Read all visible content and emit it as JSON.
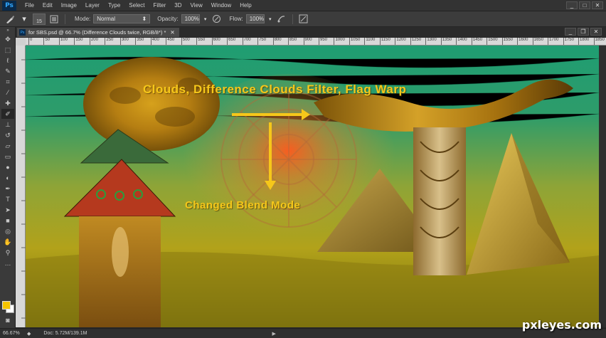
{
  "menubar": {
    "logo": "Ps",
    "items": [
      "File",
      "Edit",
      "Image",
      "Layer",
      "Type",
      "Select",
      "Filter",
      "3D",
      "View",
      "Window",
      "Help"
    ],
    "win_min": "_",
    "win_max": "□",
    "win_close": "✕"
  },
  "options": {
    "brush_size": "15",
    "mode_label": "Mode:",
    "mode_value": "Normal",
    "opacity_label": "Opacity:",
    "opacity_value": "100%",
    "flow_label": "Flow:",
    "flow_value": "100%"
  },
  "document": {
    "tab_title": "for SBS.psd @ 66.7% (Difference Clouds twice, RGB/8*) *",
    "tab_close": "✕"
  },
  "ruler": {
    "ticks": [
      "0",
      "50",
      "100",
      "150",
      "200",
      "250",
      "300",
      "350",
      "400",
      "450",
      "500",
      "550",
      "600",
      "650",
      "700",
      "750",
      "800",
      "850",
      "900",
      "950",
      "1000",
      "1050",
      "1100",
      "1150",
      "1200",
      "1250",
      "1300",
      "1350",
      "1400",
      "1450",
      "1500",
      "1550",
      "1600",
      "1650",
      "1700",
      "1750",
      "1800",
      "1850"
    ]
  },
  "canvas": {
    "title_text": "Clouds, Difference Clouds Filter, Flag Warp",
    "sub_text": "Changed Blend Mode",
    "accent_color": "#f6c71a"
  },
  "status": {
    "zoom": "66.67%",
    "doc_size": "Doc: 5.72M/139.1M"
  },
  "watermark": "pxleyes.com"
}
